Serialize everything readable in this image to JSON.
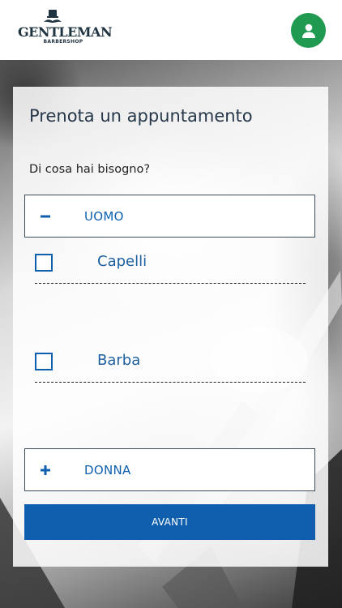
{
  "header": {
    "logo_text": "GENTLEMAN",
    "logo_sub": "BARBERSHOP",
    "profile_icon": "user-icon"
  },
  "booking": {
    "title": "Prenota un appuntamento",
    "question": "Di cosa hai bisogno?",
    "sections": [
      {
        "label": "UOMO",
        "expanded": true,
        "toggle_symbol": "−",
        "options": [
          {
            "label": "Capelli",
            "checked": false
          },
          {
            "label": "Barba",
            "checked": false
          }
        ]
      },
      {
        "label": "DONNA",
        "expanded": false,
        "toggle_symbol": "+"
      }
    ],
    "submit_label": "AVANTI"
  },
  "colors": {
    "accent_blue": "#0f5fae",
    "profile_green": "#1f9a50",
    "title_dark": "#26384a"
  }
}
